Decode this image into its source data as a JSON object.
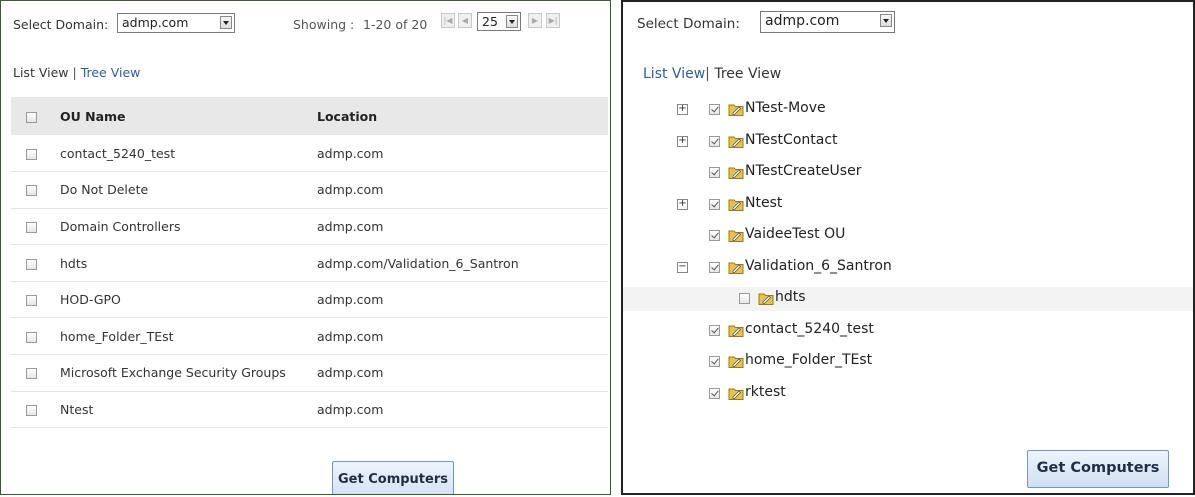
{
  "left_panel": {
    "domain_label": "Select Domain:",
    "domain_value": "admp.com",
    "showing_label": "Showing :",
    "showing_range": "1-20 of 20",
    "page_size": "25",
    "list_view_label": "List View",
    "separator": "|",
    "tree_view_label": "Tree View",
    "table": {
      "headers": [
        "OU Name",
        "Location"
      ],
      "rows": [
        {
          "name": "contact_5240_test",
          "location": "admp.com"
        },
        {
          "name": "Do Not Delete",
          "location": "admp.com"
        },
        {
          "name": "Domain Controllers",
          "location": "admp.com"
        },
        {
          "name": "hdts",
          "location": "admp.com/Validation_6_Santron"
        },
        {
          "name": "HOD-GPO",
          "location": "admp.com"
        },
        {
          "name": "home_Folder_TEst",
          "location": "admp.com"
        },
        {
          "name": "Microsoft Exchange Security Groups",
          "location": "admp.com"
        },
        {
          "name": "Ntest",
          "location": "admp.com"
        }
      ]
    },
    "button_label": "Get Computers"
  },
  "right_panel": {
    "domain_label": "Select Domain:",
    "domain_value": "admp.com",
    "list_view_label": "List View",
    "separator": "|",
    "tree_view_label": "Tree View",
    "tree": [
      {
        "label": "NTest-Move",
        "expander": "+",
        "checked": true
      },
      {
        "label": "NTestContact",
        "expander": "+",
        "checked": true
      },
      {
        "label": "NTestCreateUser",
        "expander": "",
        "checked": true
      },
      {
        "label": "Ntest",
        "expander": "+",
        "checked": true
      },
      {
        "label": "VaideeTest OU",
        "expander": "",
        "checked": true
      },
      {
        "label": "Validation_6_Santron",
        "expander": "−",
        "checked": true
      },
      {
        "label": "hdts",
        "expander": "",
        "checked": false
      },
      {
        "label": "contact_5240_test",
        "expander": "",
        "checked": true
      },
      {
        "label": "home_Folder_TEst",
        "expander": "",
        "checked": true
      },
      {
        "label": "rktest",
        "expander": "",
        "checked": true
      }
    ],
    "button_label": "Get Computers"
  }
}
